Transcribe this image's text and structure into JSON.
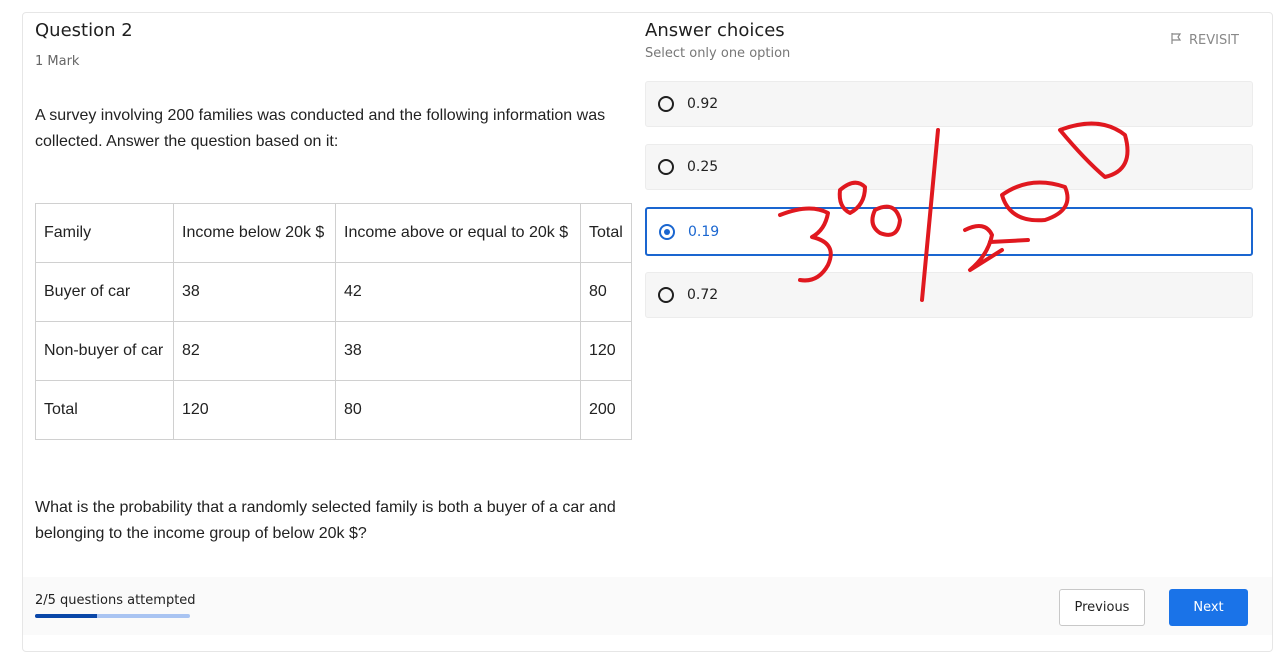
{
  "question": {
    "title": "Question 2",
    "marks": "1 Mark",
    "intro": "A survey involving 200 families was conducted and the following information was collected. Answer the question based on it:",
    "table": {
      "headers": [
        "Family",
        "Income below 20k $",
        "Income above or equal to 20k $",
        "Total"
      ],
      "rows": [
        [
          "Buyer of car",
          "38",
          "42",
          "80"
        ],
        [
          "Non-buyer of car",
          "82",
          "38",
          "120"
        ],
        [
          "Total",
          "120",
          "80",
          "200"
        ]
      ]
    },
    "text": "What is the probability that a randomly selected family is both a buyer of a car and belonging to the income group of below 20k $?"
  },
  "answers": {
    "title": "Answer choices",
    "subtitle": "Select only one option",
    "revisit_label": "REVISIT",
    "options": [
      {
        "label": "0.92",
        "selected": false
      },
      {
        "label": "0.25",
        "selected": false
      },
      {
        "label": "0.19",
        "selected": true
      },
      {
        "label": "0.72",
        "selected": false
      }
    ]
  },
  "footer": {
    "progress_text": "2/5 questions attempted",
    "progress_fraction": 0.4,
    "previous_label": "Previous",
    "next_label": "Next"
  },
  "colors": {
    "accent": "#1a73e8",
    "selected_border": "#1a66d0",
    "scribble": "#e0181f"
  },
  "icons": {
    "revisit": "flag-icon"
  }
}
